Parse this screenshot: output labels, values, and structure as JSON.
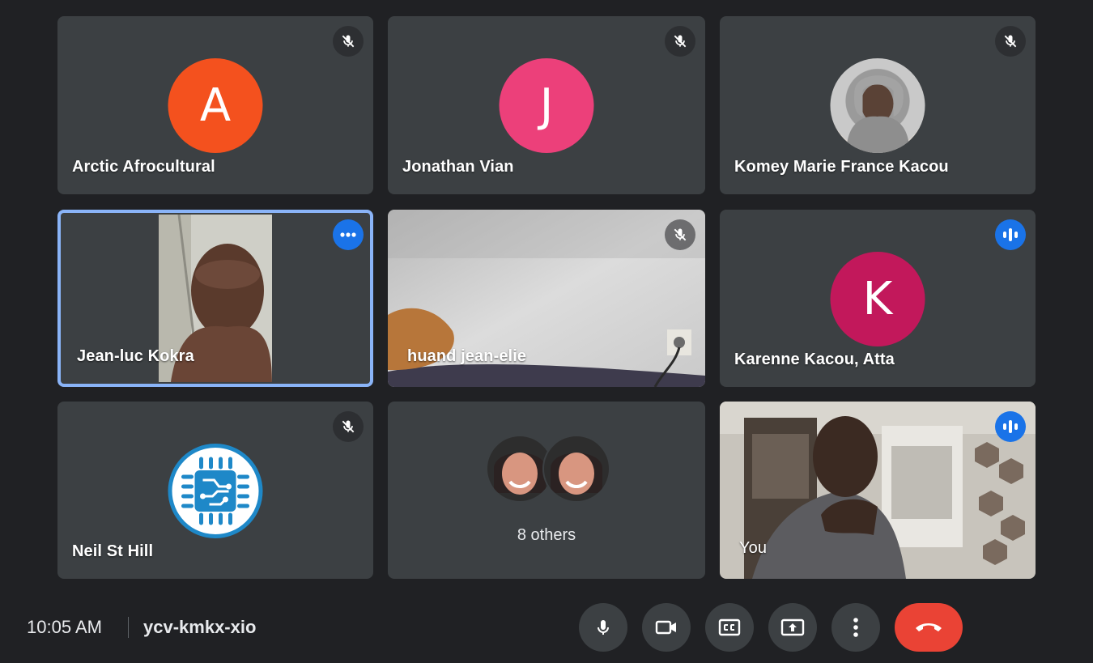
{
  "participants": [
    {
      "name": "Arctic Afrocultural",
      "initial": "A",
      "avatar_color": "#f4511e",
      "mic": "muted"
    },
    {
      "name": "Jonathan Vian",
      "initial": "J",
      "avatar_color": "#ec407a",
      "mic": "muted"
    },
    {
      "name": "Komey Marie France Kacou",
      "mic": "muted"
    },
    {
      "name": "Jean-luc Kokra",
      "mic": "more-options",
      "active_speaker": true
    },
    {
      "name": "huand jean-elie",
      "mic": "muted"
    },
    {
      "name": "Karenne Kacou, Atta",
      "initial": "K",
      "avatar_color": "#c2185b",
      "mic": "speaking"
    },
    {
      "name": "Neil St Hill",
      "mic": "muted"
    },
    {
      "others_label": "8 others"
    },
    {
      "name": "You",
      "mic": "speaking"
    }
  ],
  "footer": {
    "time": "10:05 AM",
    "meeting_code": "ycv-kmkx-xio"
  },
  "controls": [
    {
      "icon": "microphone-icon"
    },
    {
      "icon": "camera-icon"
    },
    {
      "icon": "captions-icon"
    },
    {
      "icon": "present-screen-icon"
    },
    {
      "icon": "more-options-icon"
    },
    {
      "icon": "end-call-icon",
      "color": "#ea4335"
    }
  ],
  "colors": {
    "background": "#202124",
    "tile": "#3c4043",
    "accent_blue": "#1a73e8",
    "active_outline": "#8ab4f8",
    "end_call": "#ea4335"
  }
}
